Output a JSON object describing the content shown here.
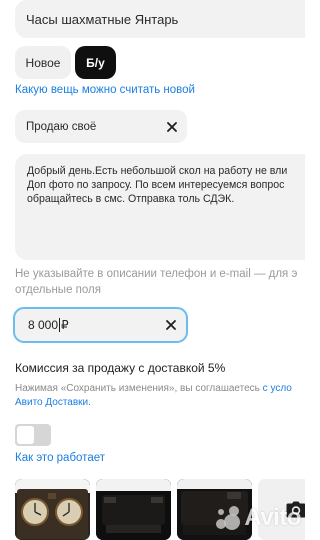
{
  "title_field": {
    "value": "Часы шахматные Янтарь"
  },
  "condition": {
    "options": [
      "Новое",
      "Б/у"
    ],
    "selected": "Б/у"
  },
  "which_new_link": "Какую вещь можно считать новой",
  "sale_type": {
    "value": "Продаю своё"
  },
  "description": {
    "lines": [
      "Добрый день.Есть небольшой скол на работу не вли",
      "Доп фото по запросу.  По всем интересуемся вопрос",
      "обращайтесь в смс. Отправка толь СДЭК."
    ]
  },
  "contacts_hint": {
    "lines": [
      "Не указывайте в описании телефон и e‑mail — для э",
      "отдельные поля"
    ]
  },
  "price_field": {
    "value": "8 000",
    "currency": "₽"
  },
  "commission_text": "Комиссия за продажу с доставкой 5%",
  "agreement": {
    "line1_prefix": "Нажимая «Сохранить изменения», вы соглашаетесь ",
    "line1_link": "с усло",
    "line2_link": "Авито Доставки."
  },
  "delivery_toggle": {
    "on": false
  },
  "how_it_works_link": "Как это работает",
  "photos": [
    {
      "icon": "clock-photo"
    },
    {
      "icon": "clock-photo"
    },
    {
      "icon": "clock-photo"
    }
  ],
  "add_photo": {
    "icon": "camera-icon"
  },
  "watermark": {
    "text": "Avito"
  },
  "colors": {
    "accent_link": "#1a7fe0",
    "focus_border": "#6bbcef",
    "field_bg": "#f2f2f2",
    "selected_button": "#0f0f0f"
  }
}
